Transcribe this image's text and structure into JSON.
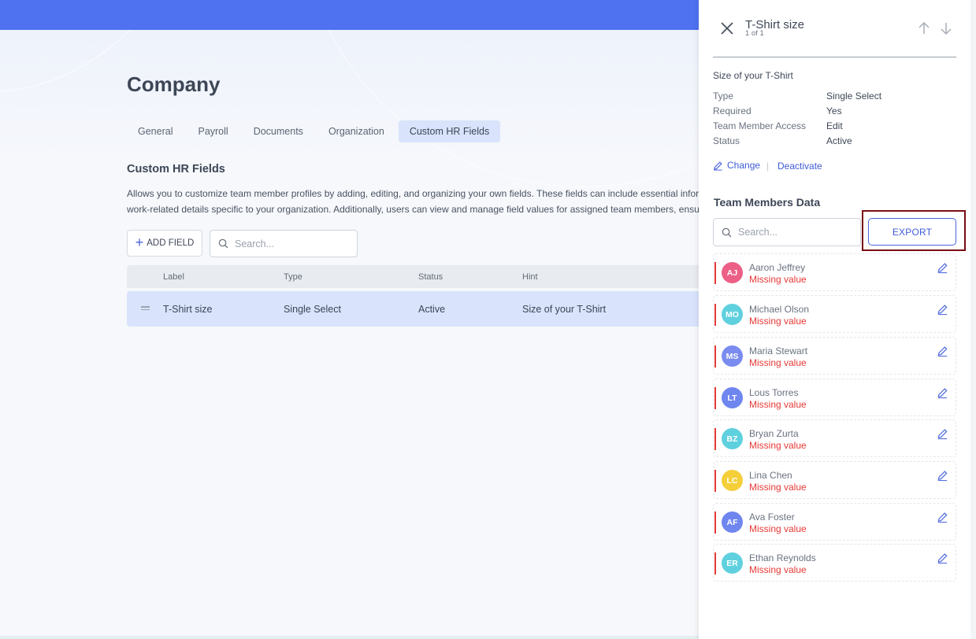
{
  "page": {
    "title": "Company",
    "tabs": [
      {
        "label": "General"
      },
      {
        "label": "Payroll"
      },
      {
        "label": "Documents"
      },
      {
        "label": "Organization"
      },
      {
        "label": "Custom HR Fields",
        "active": true
      }
    ],
    "section_title": "Custom HR Fields",
    "section_desc_line1": "Allows you to customize team member profiles by adding, editing, and organizing your own fields. These fields can include essential infor",
    "section_desc_line2": "work-related details specific to your organization. Additionally, users can view and manage field values for assigned team members, ensu",
    "add_field_label": "ADD FIELD",
    "search_placeholder": "Search...",
    "table": {
      "headers": [
        "Label",
        "Type",
        "Status",
        "Hint"
      ],
      "rows": [
        {
          "label": "T-Shirt size",
          "type": "Single Select",
          "status": "Active",
          "hint": "Size of your T-Shirt"
        }
      ]
    }
  },
  "panel": {
    "title": "T-Shirt size",
    "subtitle": "1 of 1",
    "hint": "Size of your T-Shirt",
    "properties": [
      {
        "label": "Type",
        "value": "Single Select"
      },
      {
        "label": "Required",
        "value": "Yes"
      },
      {
        "label": "Team Member Access",
        "value": "Edit"
      },
      {
        "label": "Status",
        "value": "Active"
      }
    ],
    "change_label": "Change",
    "deactivate_label": "Deactivate",
    "separator": "|",
    "team_title": "Team Members Data",
    "search_placeholder": "Search...",
    "export_label": "EXPORT",
    "members": [
      {
        "initials": "AJ",
        "name": "Aaron Jeffrey",
        "status": "Missing value",
        "color": "#ec5f86"
      },
      {
        "initials": "MO",
        "name": "Michael Olson",
        "status": "Missing value",
        "color": "#5fd0de"
      },
      {
        "initials": "MS",
        "name": "Maria Stewart",
        "status": "Missing value",
        "color": "#7a8cf0"
      },
      {
        "initials": "LT",
        "name": "Lous Torres",
        "status": "Missing value",
        "color": "#6f86ef"
      },
      {
        "initials": "BZ",
        "name": "Bryan Zurta",
        "status": "Missing value",
        "color": "#5fd0de"
      },
      {
        "initials": "LC",
        "name": "Lina Chen",
        "status": "Missing value",
        "color": "#f5cf3a"
      },
      {
        "initials": "AF",
        "name": "Ava Foster",
        "status": "Missing value",
        "color": "#6f86ef"
      },
      {
        "initials": "ER",
        "name": "Ethan Reynolds",
        "status": "Missing value",
        "color": "#5fd0de"
      }
    ]
  },
  "colors": {
    "accent": "#4e72f0",
    "link": "#3f5bd9",
    "missing": "#e53935",
    "highlight_outline": "#7a0d14"
  }
}
